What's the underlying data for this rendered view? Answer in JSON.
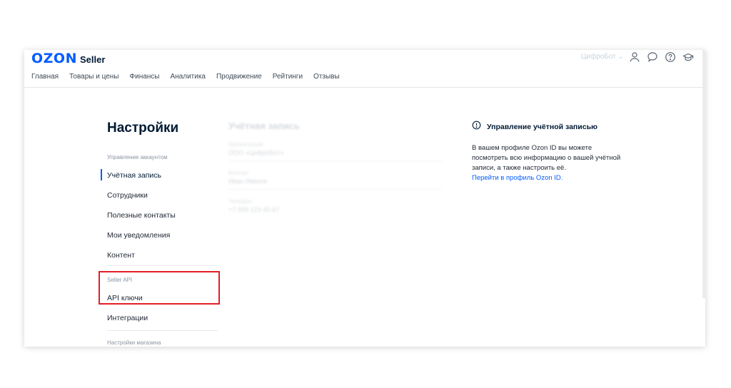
{
  "header": {
    "logo_brand": "OZON",
    "logo_product": "Seller",
    "shop_selector": "ЦифроБот ⌄",
    "icons": [
      "user-icon",
      "chat-icon",
      "help-icon",
      "education-icon"
    ]
  },
  "nav": {
    "items": [
      "Главная",
      "Товары и цены",
      "Финансы",
      "Аналитика",
      "Продвижение",
      "Рейтинги",
      "Отзывы"
    ]
  },
  "settings": {
    "title": "Настройки",
    "group_account": "Управление аккаунтом",
    "items_account": [
      "Учётная запись",
      "Сотрудники",
      "Полезные контакты",
      "Мои уведомления",
      "Контент"
    ],
    "group_api": "Seller API",
    "items_api": [
      "API ключи",
      "Интеграции"
    ],
    "group_shop": "Настройки магазина",
    "active_item": "Учётная запись"
  },
  "account": {
    "title": "Учётная запись",
    "fields": [
      {
        "label": "Организация",
        "value": "ООО «ЦифроБот»"
      },
      {
        "label": "Контакт",
        "value": "Иван Иванов"
      },
      {
        "label": "Телефон",
        "value": "+7 999 123-45-67"
      }
    ]
  },
  "info": {
    "title": "Управление учётной записью",
    "text": "В вашем профиле Ozon ID вы можете посмотреть всю информацию о вашей учётной записи, а также настроить её.",
    "link": "Перейти в профиль Ozon ID."
  },
  "colors": {
    "brand": "#005bff",
    "highlight": "#e21f26",
    "text": "#1f2733",
    "muted": "#8a96a3"
  }
}
